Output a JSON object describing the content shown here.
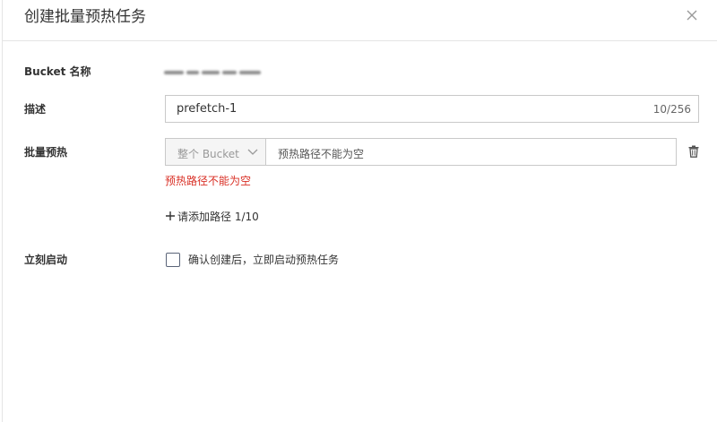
{
  "modal": {
    "title": "创建批量预热任务",
    "close_icon": "close-icon"
  },
  "form": {
    "bucket_name": {
      "label": "Bucket 名称"
    },
    "description": {
      "label": "描述",
      "value": "prefetch-1",
      "counter": "10/256"
    },
    "batch_prefetch": {
      "label": "批量预热",
      "scope_select": "整个 Bucket",
      "path_placeholder": "预热路径不能为空",
      "error": "预热路径不能为空",
      "add_path": "请添加路径 1/10",
      "delete_icon": "trash-icon"
    },
    "start_now": {
      "label": "立刻启动",
      "checkbox_label": "确认创建后，立即启动预热任务",
      "checked": false
    }
  },
  "colors": {
    "error": "#d93026",
    "border": "#c9c9c9",
    "checkbox_border": "#5a6478"
  }
}
